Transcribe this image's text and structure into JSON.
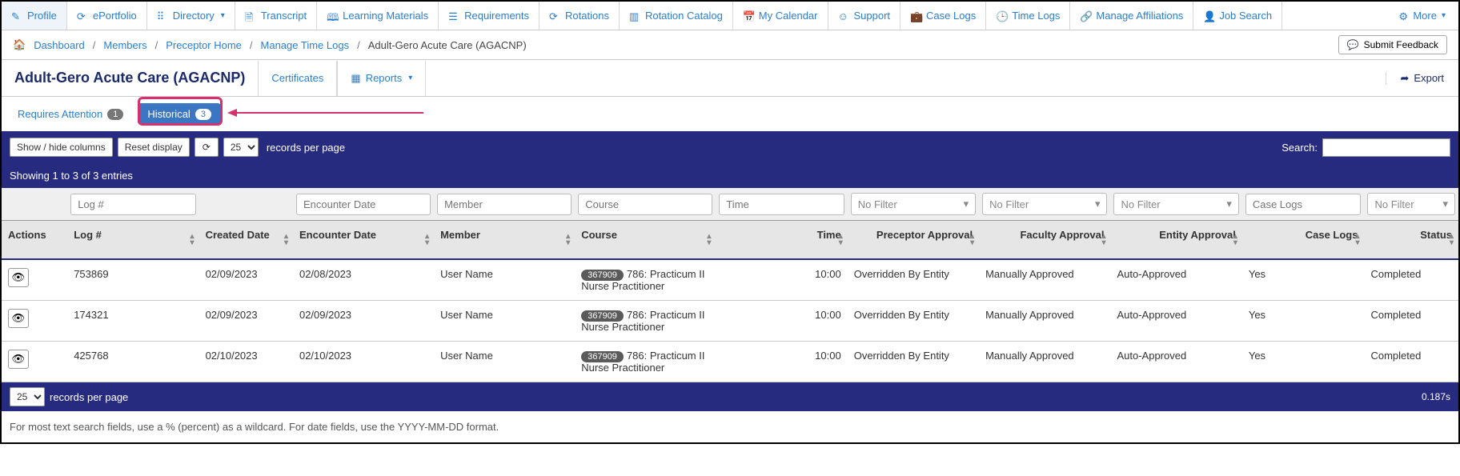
{
  "topnav": {
    "items": [
      {
        "label": "Profile",
        "icon": "pencil"
      },
      {
        "label": "ePortfolio",
        "icon": "refresh"
      },
      {
        "label": "Directory",
        "icon": "grid",
        "caret": true
      },
      {
        "label": "Transcript",
        "icon": "file"
      },
      {
        "label": "Learning Materials",
        "icon": "book"
      },
      {
        "label": "Requirements",
        "icon": "checklist"
      },
      {
        "label": "Rotations",
        "icon": "refresh"
      },
      {
        "label": "Rotation Catalog",
        "icon": "catalog"
      },
      {
        "label": "My Calendar",
        "icon": "calendar"
      },
      {
        "label": "Support",
        "icon": "support"
      },
      {
        "label": "Case Logs",
        "icon": "briefcase"
      },
      {
        "label": "Time Logs",
        "icon": "clock"
      },
      {
        "label": "Manage Affiliations",
        "icon": "link"
      },
      {
        "label": "Job Search",
        "icon": "search-person"
      }
    ],
    "more_label": "More"
  },
  "breadcrumbs": {
    "items": [
      "Dashboard",
      "Members",
      "Preceptor Home",
      "Manage Time Logs"
    ],
    "current": "Adult-Gero Acute Care (AGACNP)",
    "feedback_label": "Submit Feedback"
  },
  "titlebar": {
    "title": "Adult-Gero Acute Care (AGACNP)",
    "certificates_label": "Certificates",
    "reports_label": "Reports",
    "export_label": "Export"
  },
  "tabs": {
    "requires_label": "Requires Attention",
    "requires_count": "1",
    "historical_label": "Historical",
    "historical_count": "3"
  },
  "controls": {
    "show_hide_label": "Show / hide columns",
    "reset_label": "Reset display",
    "page_size": "25",
    "rpp_label": "records per page",
    "search_label": "Search:",
    "search_value": ""
  },
  "showing_text": "Showing 1 to 3 of 3 entries",
  "filters": {
    "log_placeholder": "Log #",
    "encounter_placeholder": "Encounter Date",
    "member_placeholder": "Member",
    "course_placeholder": "Course",
    "time_placeholder": "Time",
    "nofilter": "No Filter",
    "caselogs_placeholder": "Case Logs"
  },
  "headers": {
    "actions": "Actions",
    "log": "Log #",
    "created": "Created Date",
    "encounter": "Encounter Date",
    "member": "Member",
    "course": "Course",
    "time": "Time",
    "precept": "Preceptor Approval",
    "faculty": "Faculty Approval",
    "entity": "Entity Approval",
    "caselogs": "Case Logs",
    "status": "Status"
  },
  "rows": [
    {
      "log": "753869",
      "created": "02/09/2023",
      "encounter": "02/08/2023",
      "member": "User Name",
      "course_badge": "367909",
      "course_text": "786: Practicum II Nurse Practitioner",
      "time": "10:00",
      "precept": "Overridden By Entity",
      "faculty": "Manually Approved",
      "entity": "Auto-Approved",
      "caselogs": "Yes",
      "status": "Completed"
    },
    {
      "log": "174321",
      "created": "02/09/2023",
      "encounter": "02/09/2023",
      "member": "User Name",
      "course_badge": "367909",
      "course_text": "786: Practicum II Nurse Practitioner",
      "time": "10:00",
      "precept": "Overridden By Entity",
      "faculty": "Manually Approved",
      "entity": "Auto-Approved",
      "caselogs": "Yes",
      "status": "Completed"
    },
    {
      "log": "425768",
      "created": "02/10/2023",
      "encounter": "02/10/2023",
      "member": "User Name",
      "course_badge": "367909",
      "course_text": "786: Practicum II Nurse Practitioner",
      "time": "10:00",
      "precept": "Overridden By Entity",
      "faculty": "Manually Approved",
      "entity": "Auto-Approved",
      "caselogs": "Yes",
      "status": "Completed"
    }
  ],
  "footer": {
    "page_size": "25",
    "rpp_label": "records per page",
    "timing": "0.187s"
  },
  "hint": "For most text search fields, use a % (percent) as a wildcard. For date fields, use the YYYY-MM-DD format."
}
